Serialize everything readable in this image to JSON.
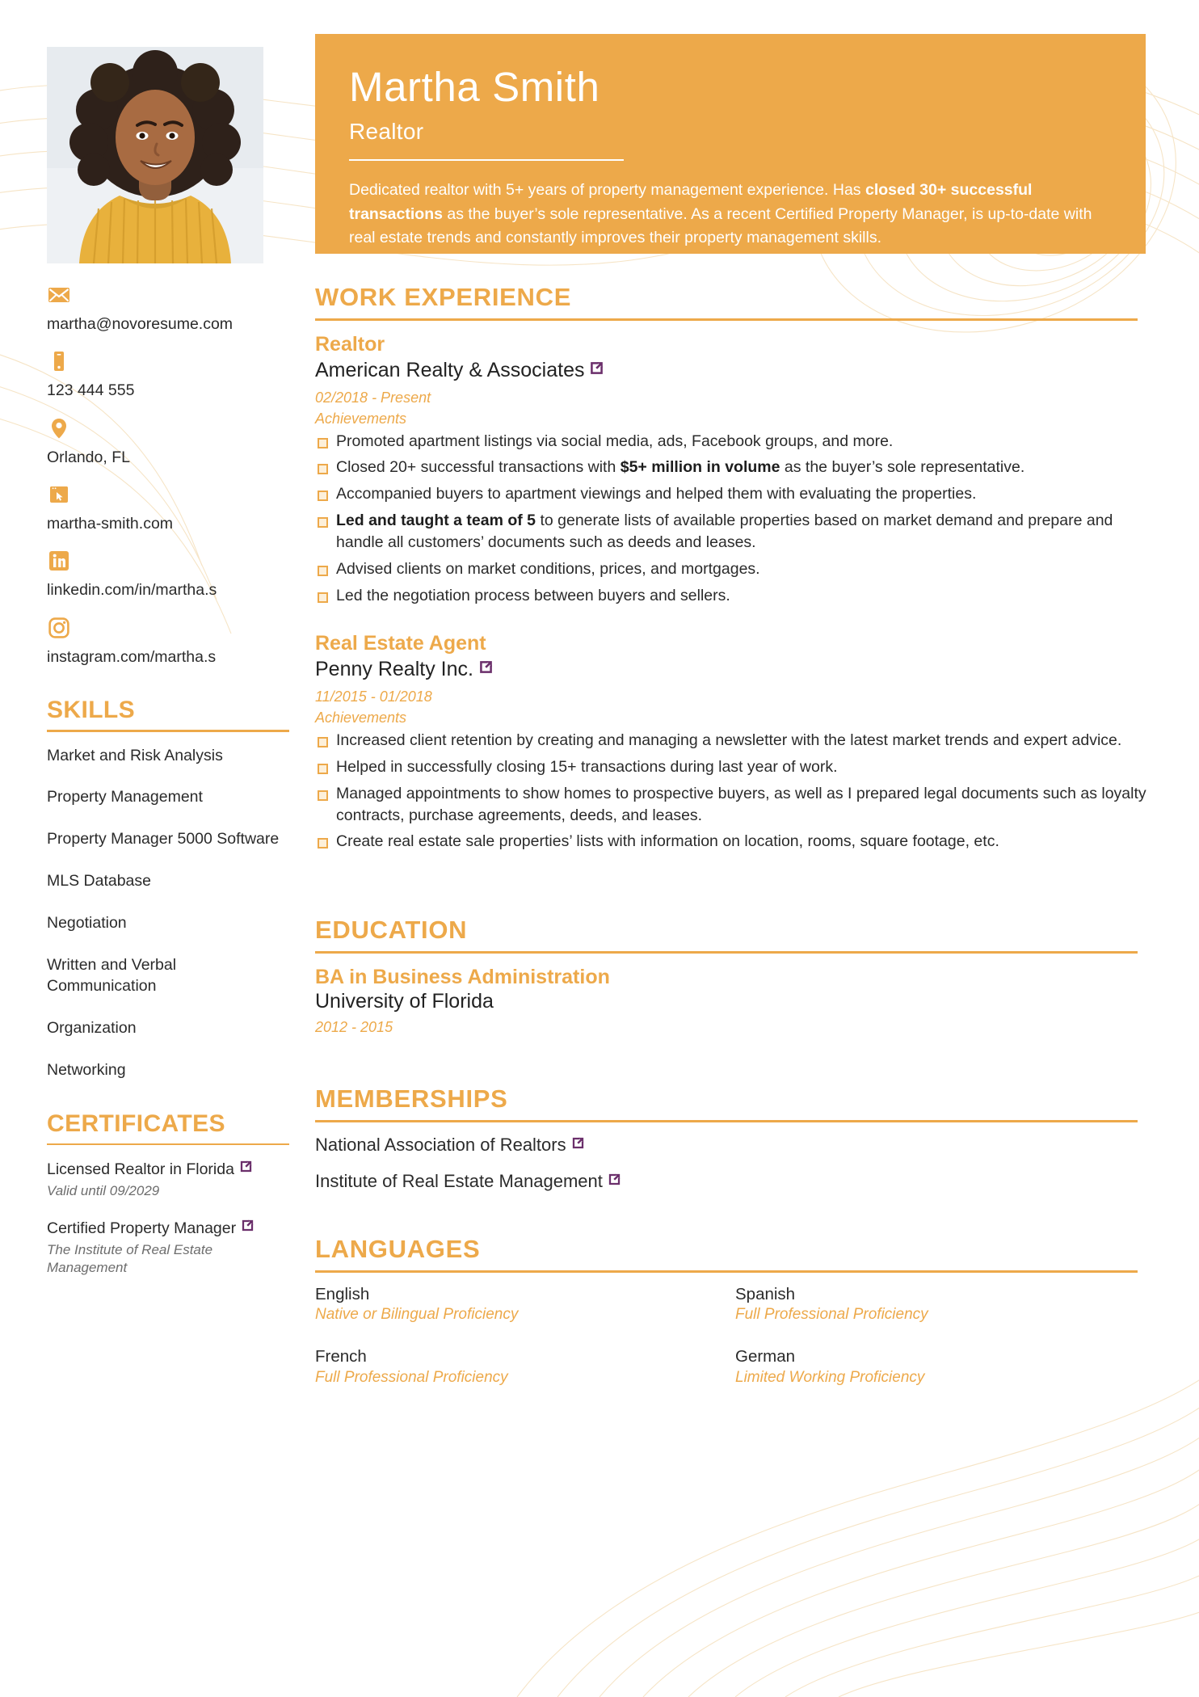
{
  "theme": {
    "accent": "#eda94a",
    "text": "#2b2b2b",
    "muted": "#6d6d6d",
    "link_icon": "#6b2f6b"
  },
  "header": {
    "name": "Martha Smith",
    "job_title": "Realtor",
    "summary_part1": "Dedicated realtor with 5+ years of property management experience. Has ",
    "summary_bold": "closed 30+ successful transactions",
    "summary_part2": " as the buyer’s sole representative. As a recent Certified Property Manager, is up-to-date with real estate trends and constantly improves their property management skills."
  },
  "contact": {
    "items": [
      {
        "icon": "envelope-icon",
        "text": "martha@novoresume.com"
      },
      {
        "icon": "phone-icon",
        "text": "123 444 555"
      },
      {
        "icon": "location-pin-icon",
        "text": "Orlando, FL"
      },
      {
        "icon": "website-icon",
        "text": "martha-smith.com"
      },
      {
        "icon": "linkedin-icon",
        "text": "linkedin.com/in/martha.s"
      },
      {
        "icon": "instagram-icon",
        "text": "instagram.com/martha.s"
      }
    ]
  },
  "skills": {
    "heading": "SKILLS",
    "items": [
      "Market and Risk Analysis",
      "Property Management",
      "Property Manager 5000 Software",
      "MLS Database",
      "Negotiation",
      "Written and Verbal Communication",
      "Organization",
      "Networking"
    ]
  },
  "certificates": {
    "heading": "CERTIFICATES",
    "items": [
      {
        "name": "Licensed Realtor in Florida",
        "sub": "Valid until 09/2029",
        "has_link": true
      },
      {
        "name": "Certified Property Manager",
        "sub": "The Institute of Real Estate Management",
        "has_link": true
      }
    ]
  },
  "work_experience": {
    "heading": "WORK EXPERIENCE",
    "achievements_label": "Achievements",
    "jobs": [
      {
        "role": "Realtor",
        "company": "American Realty & Associates",
        "has_link": true,
        "dates": "02/2018 - Present",
        "bullets": [
          {
            "pre": "",
            "bold": "",
            "post": "Promoted apartment listings via social media, ads, Facebook groups, and more."
          },
          {
            "pre": "Closed 20+ successful transactions with ",
            "bold": "$5+ million in volume",
            "post": " as the buyer’s sole representative."
          },
          {
            "pre": "",
            "bold": "",
            "post": "Accompanied buyers to apartment viewings and helped them with evaluating the properties."
          },
          {
            "pre": "",
            "bold": "Led and taught a team of 5",
            "post": " to generate lists of available properties based on market demand and prepare and handle all customers’ documents such as deeds and leases."
          },
          {
            "pre": "",
            "bold": "",
            "post": "Advised clients on market conditions, prices, and mortgages."
          },
          {
            "pre": "",
            "bold": "",
            "post": "Led the negotiation process between buyers and sellers."
          }
        ]
      },
      {
        "role": "Real Estate Agent",
        "company": "Penny Realty Inc.",
        "has_link": true,
        "dates": "11/2015 - 01/2018",
        "bullets": [
          {
            "pre": "",
            "bold": "",
            "post": "Increased client retention by creating and managing a newsletter with the latest market trends and expert advice."
          },
          {
            "pre": "",
            "bold": "",
            "post": "Helped in successfully closing 15+ transactions during last year of work."
          },
          {
            "pre": "",
            "bold": "",
            "post": "Managed appointments to show homes to prospective buyers, as well as I prepared legal documents such as loyalty contracts, purchase agreements, deeds, and leases."
          },
          {
            "pre": "",
            "bold": "",
            "post": "Create real estate sale properties’ lists with information on location, rooms, square footage, etc."
          }
        ]
      }
    ]
  },
  "education": {
    "heading": "EDUCATION",
    "entries": [
      {
        "degree": "BA in Business Administration",
        "school": "University of Florida",
        "dates": "2012 - 2015"
      }
    ]
  },
  "memberships": {
    "heading": "MEMBERSHIPS",
    "items": [
      {
        "name": "National Association of Realtors",
        "has_link": true
      },
      {
        "name": "Institute of Real Estate Management",
        "has_link": true
      }
    ]
  },
  "languages": {
    "heading": "LANGUAGES",
    "items": [
      {
        "name": "English",
        "level": "Native or Bilingual Proficiency"
      },
      {
        "name": "Spanish",
        "level": "Full Professional Proficiency"
      },
      {
        "name": "French",
        "level": "Full Professional Proficiency"
      },
      {
        "name": "German",
        "level": "Limited Working Proficiency"
      }
    ]
  }
}
